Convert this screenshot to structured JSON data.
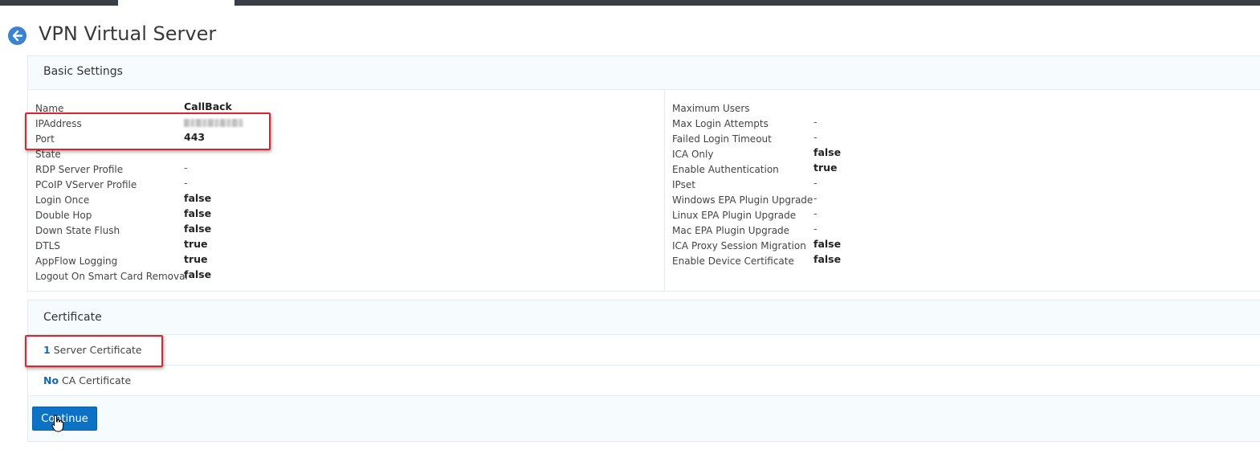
{
  "header": {
    "title": "VPN Virtual Server"
  },
  "basic_settings": {
    "title": "Basic Settings",
    "left": [
      {
        "key": "Name",
        "value": "CallBack"
      },
      {
        "key": "IPAddress",
        "value": ""
      },
      {
        "key": "Port",
        "value": "443"
      },
      {
        "key": "State",
        "value": ""
      },
      {
        "key": "RDP Server Profile",
        "value": "-"
      },
      {
        "key": "PCoIP VServer Profile",
        "value": "-"
      },
      {
        "key": "Login Once",
        "value": "false"
      },
      {
        "key": "Double Hop",
        "value": "false"
      },
      {
        "key": "Down State Flush",
        "value": "false"
      },
      {
        "key": "DTLS",
        "value": "true"
      },
      {
        "key": "AppFlow Logging",
        "value": "true"
      },
      {
        "key": "Logout On Smart Card Removal",
        "value": "false"
      }
    ],
    "right": [
      {
        "key": "Maximum Users",
        "value": ""
      },
      {
        "key": "Max Login Attempts",
        "value": "-"
      },
      {
        "key": "Failed Login Timeout",
        "value": "-"
      },
      {
        "key": "ICA Only",
        "value": "false"
      },
      {
        "key": "Enable Authentication",
        "value": "true"
      },
      {
        "key": "IPset",
        "value": "-"
      },
      {
        "key": "Windows EPA Plugin Upgrade",
        "value": "-"
      },
      {
        "key": "Linux EPA Plugin Upgrade",
        "value": "-"
      },
      {
        "key": "Mac EPA Plugin Upgrade",
        "value": "-"
      },
      {
        "key": "ICA Proxy Session Migration",
        "value": "false"
      },
      {
        "key": "Enable Device Certificate",
        "value": "false"
      }
    ]
  },
  "certificate": {
    "title": "Certificate",
    "server": {
      "count": "1",
      "label": "Server Certificate"
    },
    "ca": {
      "count": "No",
      "label": "CA Certificate"
    },
    "continue_label": "Continue"
  },
  "colors": {
    "accent": "#0b72c6",
    "highlight": "#d9262c",
    "link": "#0e6bb5"
  },
  "icons": {
    "back": "arrow-left-circle-icon",
    "cursor": "hand-pointer-icon"
  }
}
